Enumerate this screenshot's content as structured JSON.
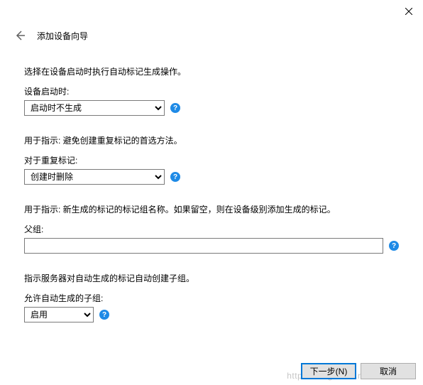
{
  "window": {
    "title": "添加设备向导"
  },
  "sections": {
    "startup": {
      "desc": "选择在设备启动时执行自动标记生成操作。",
      "label": "设备启动时:",
      "value": "启动时不生成"
    },
    "duplicate": {
      "desc": "用于指示: 避免创建重复标记的首选方法。",
      "label": "对于重复标记:",
      "value": "创建时删除"
    },
    "parent": {
      "desc": "用于指示: 新生成的标记的标记组名称。如果留空，则在设备级别添加生成的标记。",
      "label": "父组:",
      "value": ""
    },
    "subgroup": {
      "desc": "指示服务器对自动生成的标记自动创建子组。",
      "label": "允许自动生成的子组:",
      "value": "启用"
    }
  },
  "buttons": {
    "next": "下一步(N)",
    "cancel": "取消"
  },
  "help": "?",
  "watermark": "https://blog.csdn.net/"
}
